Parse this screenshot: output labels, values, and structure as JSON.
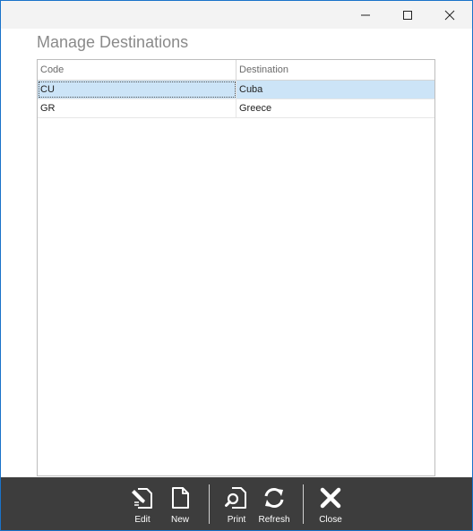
{
  "page": {
    "title": "Manage Destinations"
  },
  "grid": {
    "columns": [
      "Code",
      "Destination"
    ],
    "rows": [
      {
        "code": "CU",
        "destination": "Cuba",
        "selected": true
      },
      {
        "code": "GR",
        "destination": "Greece",
        "selected": false
      }
    ]
  },
  "toolbar": {
    "edit_label": "Edit",
    "new_label": "New",
    "print_label": "Print",
    "refresh_label": "Refresh",
    "close_label": "Close"
  },
  "colors": {
    "toolbar_bg": "#3d3d3d",
    "selected_row": "#cce4f7",
    "window_border": "#1a73c9"
  }
}
